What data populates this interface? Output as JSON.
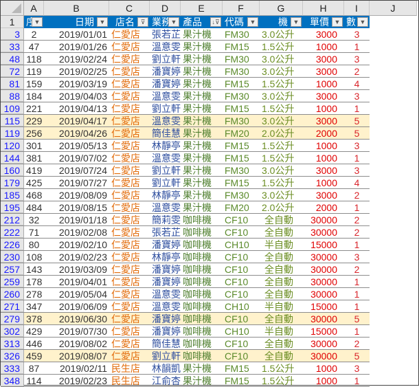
{
  "column_letters": [
    "A",
    "B",
    "C",
    "D",
    "E",
    "F",
    "G",
    "H",
    "I",
    "J"
  ],
  "header_row_number": "1",
  "headers": [
    {
      "label": "序",
      "filter": "dropdown"
    },
    {
      "label": "日期",
      "filter": "dropdown"
    },
    {
      "label": "店名",
      "filter": "filtered"
    },
    {
      "label": "業務",
      "filter": "dropdown"
    },
    {
      "label": "產品",
      "filter": "sorted-filtered"
    },
    {
      "label": "代碼",
      "filter": "dropdown"
    },
    {
      "label": "機",
      "filter": "dropdown"
    },
    {
      "label": "單價",
      "filter": "dropdown"
    },
    {
      "label": "數",
      "filter": "dropdown"
    }
  ],
  "colors": {
    "header_bg": "#0070c0",
    "highlight": "#fff2cc",
    "store": "#e26b0a",
    "sales": "#2f4f9f",
    "product": "#4f7f2f",
    "code": "#5a8a2a",
    "spec": "#6b8e23",
    "price": "#e00000",
    "qty": "#d9262c",
    "row_number": "#1a1aff"
  },
  "rows": [
    [
      "3",
      "2",
      "2019/01/01",
      "仁愛店",
      "張若芷",
      "果汁機",
      "FM30",
      "3.0公升",
      "3000",
      "3",
      false
    ],
    [
      "33",
      "47",
      "2019/01/26",
      "仁愛店",
      "溫意雯",
      "果汁機",
      "FM15",
      "1.5公升",
      "1000",
      "1",
      false
    ],
    [
      "48",
      "118",
      "2019/02/24",
      "仁愛店",
      "劉立軒",
      "果汁機",
      "FM30",
      "3.0公升",
      "3000",
      "3",
      false
    ],
    [
      "72",
      "119",
      "2019/02/25",
      "仁愛店",
      "潘寶婷",
      "果汁機",
      "FM30",
      "3.0公升",
      "3000",
      "2",
      false
    ],
    [
      "81",
      "159",
      "2019/03/19",
      "仁愛店",
      "潘寶婷",
      "果汁機",
      "FM15",
      "1.5公升",
      "1000",
      "4",
      false
    ],
    [
      "88",
      "184",
      "2019/04/03",
      "仁愛店",
      "溫意雯",
      "果汁機",
      "FM30",
      "3.0公升",
      "3000",
      "3",
      false
    ],
    [
      "109",
      "221",
      "2019/04/13",
      "仁愛店",
      "劉立軒",
      "果汁機",
      "FM15",
      "1.5公升",
      "1000",
      "1",
      false
    ],
    [
      "115",
      "229",
      "2019/04/17",
      "仁愛店",
      "溫意雯",
      "果汁機",
      "FM30",
      "3.0公升",
      "3000",
      "5",
      true
    ],
    [
      "119",
      "256",
      "2019/04/26",
      "仁愛店",
      "簡佳慧",
      "果汁機",
      "FM20",
      "2.0公升",
      "2000",
      "5",
      true
    ],
    [
      "120",
      "301",
      "2019/05/13",
      "仁愛店",
      "林靜亭",
      "果汁機",
      "FM15",
      "1.5公升",
      "1000",
      "3",
      false
    ],
    [
      "144",
      "381",
      "2019/07/02",
      "仁愛店",
      "溫意雯",
      "果汁機",
      "FM15",
      "1.5公升",
      "1000",
      "1",
      false
    ],
    [
      "160",
      "419",
      "2019/07/24",
      "仁愛店",
      "劉立軒",
      "果汁機",
      "FM30",
      "3.0公升",
      "3000",
      "3",
      false
    ],
    [
      "179",
      "425",
      "2019/07/27",
      "仁愛店",
      "劉立軒",
      "果汁機",
      "FM15",
      "1.5公升",
      "1000",
      "4",
      false
    ],
    [
      "185",
      "468",
      "2019/08/09",
      "仁愛店",
      "林靜亭",
      "果汁機",
      "FM30",
      "3.0公升",
      "3000",
      "2",
      false
    ],
    [
      "195",
      "484",
      "2019/08/15",
      "仁愛店",
      "溫意雯",
      "果汁機",
      "FM20",
      "2.0公升",
      "2000",
      "1",
      false
    ],
    [
      "212",
      "32",
      "2019/01/18",
      "仁愛店",
      "簡莉雯",
      "咖啡機",
      "CF10",
      "全自動",
      "30000",
      "2",
      false
    ],
    [
      "222",
      "71",
      "2019/02/08",
      "仁愛店",
      "張若芷",
      "咖啡機",
      "CF10",
      "全自動",
      "30000",
      "2",
      false
    ],
    [
      "226",
      "80",
      "2019/02/10",
      "仁愛店",
      "潘寶婷",
      "咖啡機",
      "CH10",
      "半自動",
      "15000",
      "1",
      false
    ],
    [
      "230",
      "108",
      "2019/02/23",
      "仁愛店",
      "林靜亭",
      "咖啡機",
      "CF10",
      "全自動",
      "30000",
      "3",
      false
    ],
    [
      "257",
      "143",
      "2019/03/09",
      "仁愛店",
      "潘寶婷",
      "咖啡機",
      "CF10",
      "全自動",
      "30000",
      "2",
      false
    ],
    [
      "259",
      "178",
      "2019/04/01",
      "仁愛店",
      "潘寶婷",
      "咖啡機",
      "CF10",
      "全自動",
      "30000",
      "1",
      false
    ],
    [
      "260",
      "278",
      "2019/05/04",
      "仁愛店",
      "溫意雯",
      "咖啡機",
      "CF10",
      "全自動",
      "30000",
      "1",
      false
    ],
    [
      "271",
      "347",
      "2019/06/09",
      "仁愛店",
      "溫意雯",
      "咖啡機",
      "CH10",
      "半自動",
      "15000",
      "1",
      false
    ],
    [
      "279",
      "378",
      "2019/06/30",
      "仁愛店",
      "潘寶婷",
      "咖啡機",
      "CF10",
      "全自動",
      "30000",
      "5",
      true
    ],
    [
      "302",
      "429",
      "2019/07/30",
      "仁愛店",
      "潘寶婷",
      "咖啡機",
      "CH10",
      "半自動",
      "15000",
      "1",
      false
    ],
    [
      "313",
      "446",
      "2019/08/02",
      "仁愛店",
      "簡佳慧",
      "咖啡機",
      "CF10",
      "全自動",
      "30000",
      "2",
      false
    ],
    [
      "326",
      "459",
      "2019/08/07",
      "仁愛店",
      "劉立軒",
      "咖啡機",
      "CF10",
      "全自動",
      "30000",
      "5",
      true
    ],
    [
      "333",
      "87",
      "2019/02/11",
      "民生店",
      "林韻凱",
      "果汁機",
      "FM15",
      "1.5公升",
      "1000",
      "3",
      false
    ],
    [
      "348",
      "114",
      "2019/02/23",
      "民生店",
      "江俞杏",
      "果汁機",
      "FM15",
      "1.5公升",
      "1000",
      "1",
      false
    ]
  ]
}
